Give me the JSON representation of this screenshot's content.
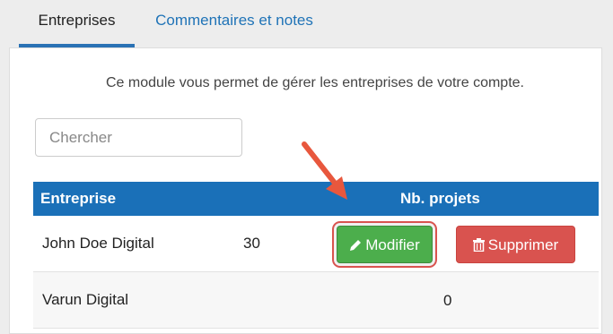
{
  "tabs": [
    {
      "label": "Entreprises"
    },
    {
      "label": "Commentaires et notes"
    }
  ],
  "description": "Ce module vous permet de gérer les entreprises de votre compte.",
  "search": {
    "placeholder": "Chercher"
  },
  "table": {
    "headers": [
      "Entreprise",
      "Nb. projets"
    ],
    "rows": [
      {
        "name": "John Doe Digital",
        "projects": "30"
      },
      {
        "name": "Varun Digital",
        "projects": "0"
      }
    ]
  },
  "actions": {
    "edit_label": "Modifier",
    "delete_label": "Supprimer"
  },
  "colors": {
    "header": "#1a70b8",
    "edit": "#4cae4c",
    "delete": "#d9534f",
    "accent": "#2a72b5"
  }
}
